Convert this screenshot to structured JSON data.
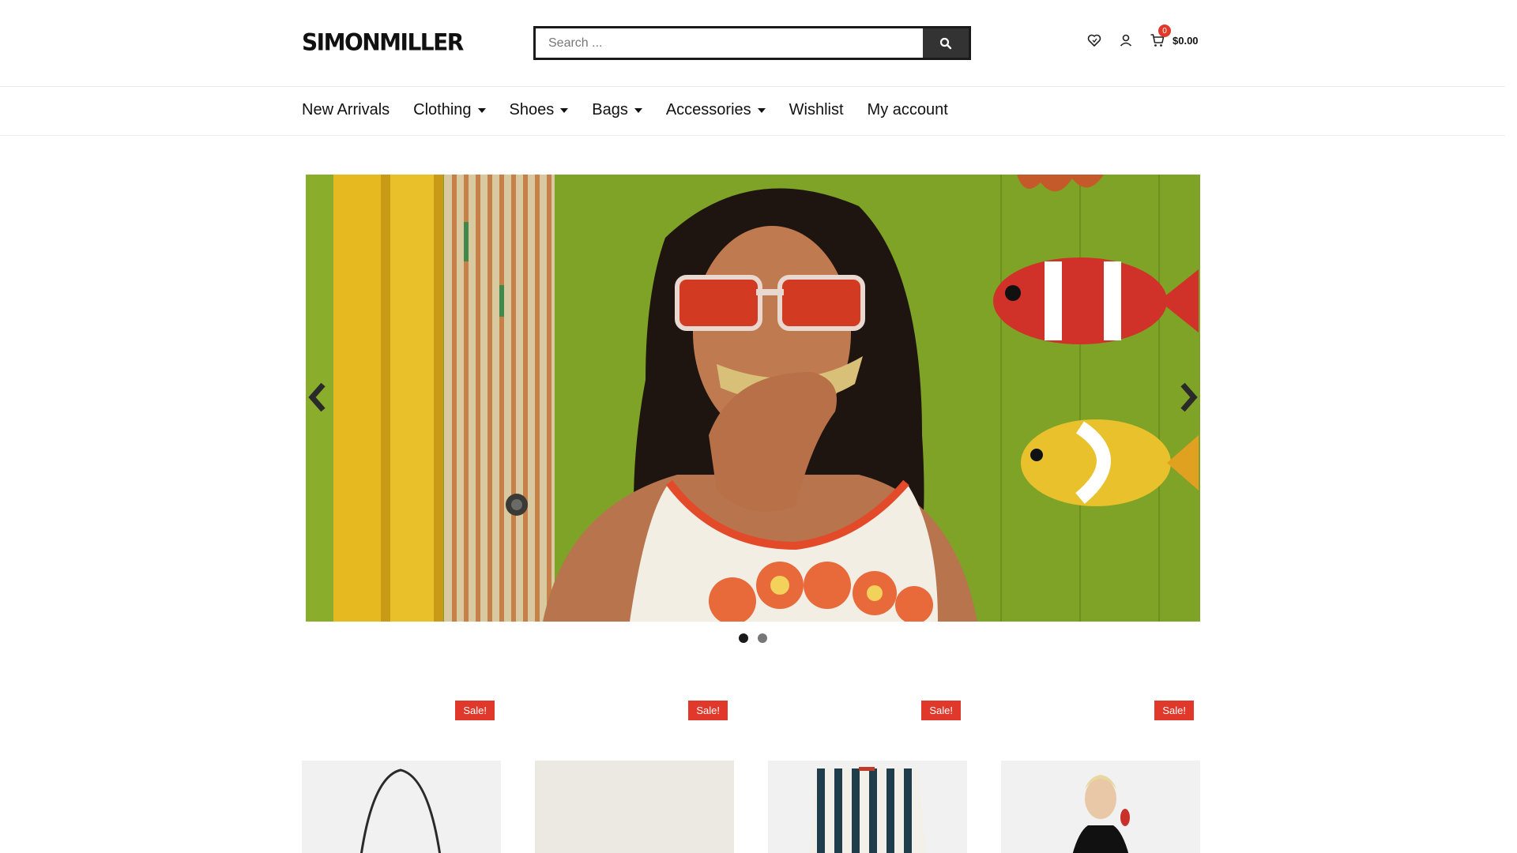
{
  "header": {
    "logo": "SIMONMILLER",
    "search": {
      "placeholder": "Search ..."
    },
    "icons": [
      "heart-icon",
      "user-icon",
      "cart-icon"
    ],
    "cart": {
      "count": "0",
      "total": "$0.00"
    }
  },
  "nav": {
    "items": [
      {
        "label": "New Arrivals",
        "dropdown": false
      },
      {
        "label": "Clothing",
        "dropdown": true
      },
      {
        "label": "Shoes",
        "dropdown": true
      },
      {
        "label": "Bags",
        "dropdown": true
      },
      {
        "label": "Accessories",
        "dropdown": true
      },
      {
        "label": "Wishlist",
        "dropdown": false
      },
      {
        "label": "My account",
        "dropdown": false
      }
    ]
  },
  "slider": {
    "active_slide": 1,
    "slide_count": 2
  },
  "products": [
    {
      "badge": "Sale!"
    },
    {
      "badge": "Sale!"
    },
    {
      "badge": "Sale!"
    },
    {
      "badge": "Sale!"
    }
  ],
  "colors": {
    "accent": "#e0382b",
    "text": "#111111",
    "search_button": "#333333"
  }
}
